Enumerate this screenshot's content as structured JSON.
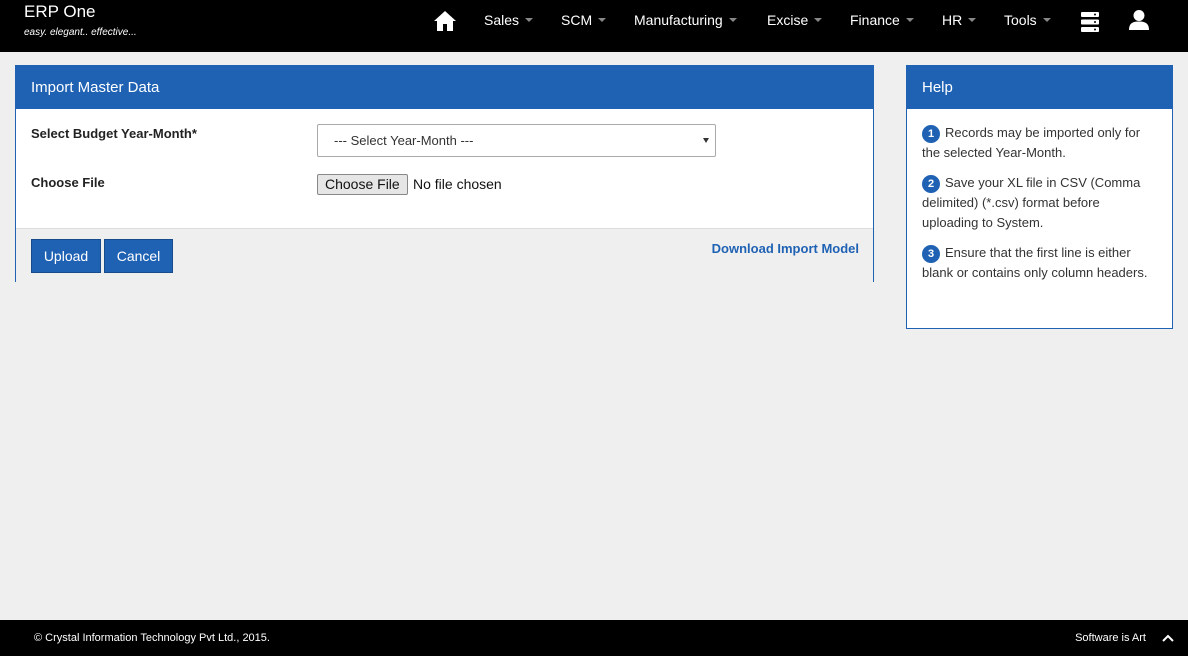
{
  "app": {
    "name": "ERP One",
    "tagline": "easy. elegant.. effective..."
  },
  "nav": {
    "items": [
      {
        "label": "Sales"
      },
      {
        "label": "SCM"
      },
      {
        "label": "Manufacturing"
      },
      {
        "label": "Excise"
      },
      {
        "label": "Finance"
      },
      {
        "label": "HR"
      },
      {
        "label": "Tools"
      }
    ],
    "icons": [
      "home-icon",
      "server-icon",
      "user-icon"
    ]
  },
  "import_panel": {
    "title": "Import Master Data",
    "year_month_label": "Select Budget Year-Month*",
    "year_month_selected": "--- Select Year-Month ---",
    "file_label": "Choose File",
    "file_button": "Choose File",
    "file_status": "No file chosen",
    "upload_label": "Upload",
    "cancel_label": "Cancel",
    "download_link": "Download Import Model"
  },
  "help": {
    "title": "Help",
    "items": [
      {
        "num": "1",
        "text": "Records may be imported only for the selected Year-Month."
      },
      {
        "num": "2",
        "text": "Save your XL file in CSV (Comma delimited) (*.csv) format before uploading to System."
      },
      {
        "num": "3",
        "text": "Ensure that the first line is either blank or contains only column headers."
      }
    ]
  },
  "footer": {
    "copyright": "© Crystal Information Technology Pvt Ltd., 2015.",
    "slogan": "Software is Art"
  },
  "colors": {
    "accent": "#1f62b4",
    "topbar": "#000000",
    "background": "#efefef"
  }
}
